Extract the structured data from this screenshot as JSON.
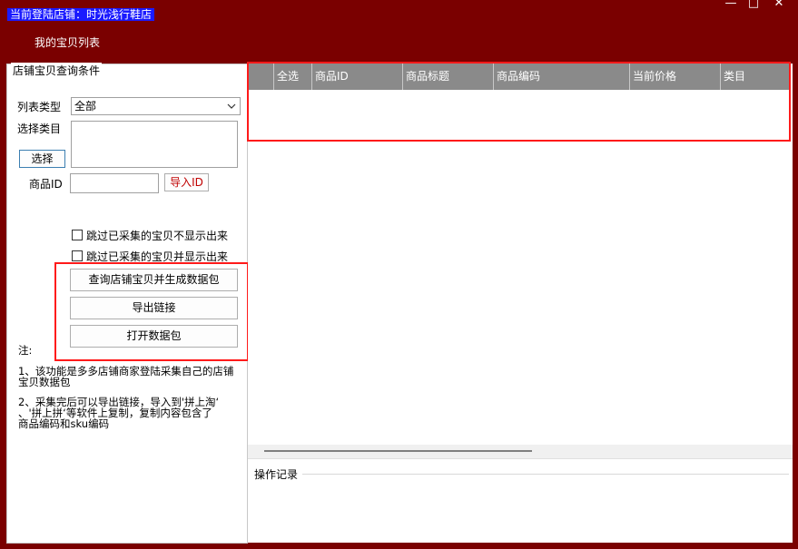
{
  "window": {
    "store_label": "当前登陆店铺：时光浅行鞋店",
    "minimize_glyph": "—",
    "maximize_glyph": "□",
    "close_glyph": "✕"
  },
  "tab": {
    "label": "我的宝贝列表"
  },
  "query_panel": {
    "group_title": "店铺宝贝查询条件",
    "list_type_label": "列表类型",
    "list_type_value": "全部",
    "category_label": "选择类目",
    "choose_button": "选择",
    "product_id_label": "商品ID",
    "product_id_value": "",
    "import_id_button": "导入ID",
    "checkbox_skip_hide": "跳过已采集的宝贝不显示出来",
    "checkbox_skip_show": "跳过已采集的宝贝并显示出来",
    "query_button": "查询店铺宝贝并生成数据包",
    "export_button": "导出链接",
    "open_button": "打开数据包"
  },
  "notes": {
    "title": "注:",
    "line1a": "1、该功能是多多店铺商家登陆采集自己的店铺",
    "line1b": "宝贝数据包",
    "line2a": "2、采集完后可以导出链接，导入到'拼上淘‘",
    "line2b": "、'拼上拼‘等软件上复制，复制内容包含了",
    "line2c": "商品编码和sku编码"
  },
  "grid": {
    "columns": [
      "全选",
      "商品ID",
      "商品标题",
      "商品编码",
      "当前价格",
      "类目"
    ]
  },
  "log": {
    "title": "操作记录"
  },
  "colors": {
    "background": "#7a0000",
    "store_label_bg": "#1a1aff",
    "highlight": "#ff1a1a",
    "grid_header": "#8a8a8a"
  }
}
